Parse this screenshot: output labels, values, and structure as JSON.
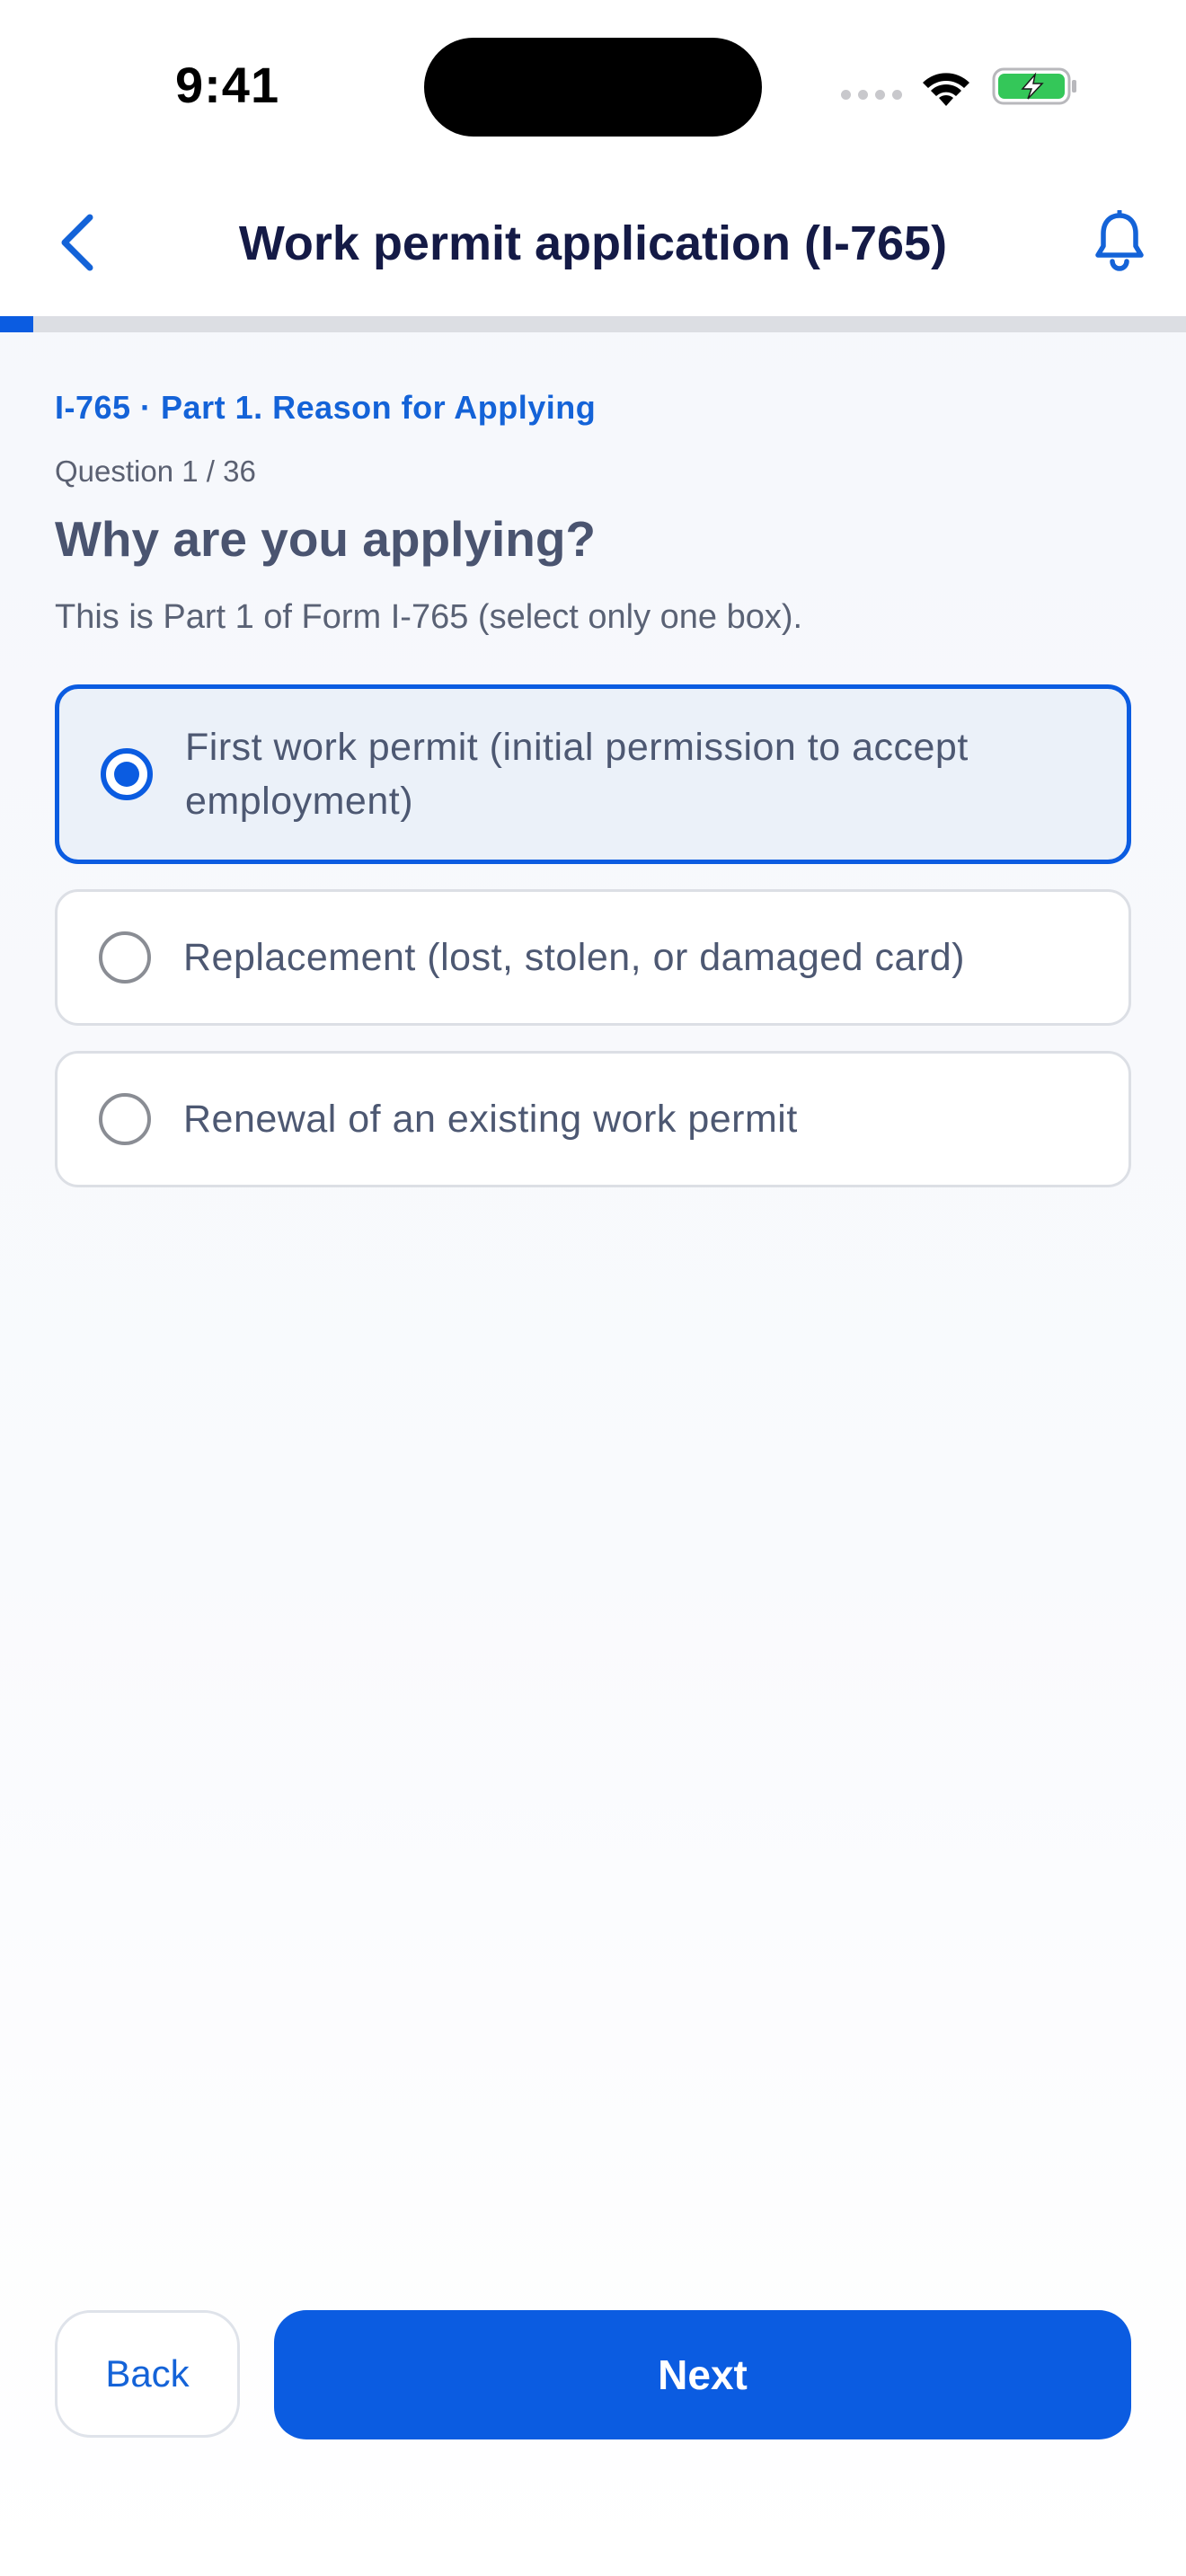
{
  "status_bar": {
    "time": "9:41"
  },
  "header": {
    "title": "Work permit application (I-765)",
    "back_icon": "chevron-left-icon",
    "notification_icon": "bell-icon"
  },
  "progress": {
    "fraction": 0.0278,
    "label_hidden": true
  },
  "form": {
    "section_label": "I-765 · Part 1. Reason for Applying",
    "question_count": "Question 1 / 36",
    "question": "Why are you applying?",
    "help_text": "This is Part 1 of Form I-765 (select only one box).",
    "options": [
      {
        "label": "First work permit (initial permission to accept employment)",
        "selected": true
      },
      {
        "label": "Replacement (lost, stolen, or damaged card)",
        "selected": false
      },
      {
        "label": "Renewal of an existing work permit",
        "selected": false
      }
    ]
  },
  "actions": {
    "back_label": "Back",
    "next_label": "Next"
  },
  "colors": {
    "accent": "#0b5ce1",
    "title": "#141a46",
    "selected_bg": "#ebf1f9",
    "battery_fill": "#34c759"
  }
}
